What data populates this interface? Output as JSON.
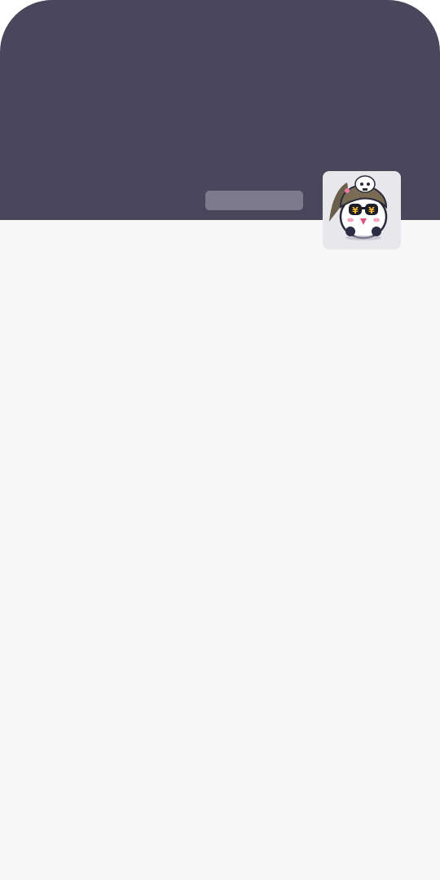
{
  "colors": {
    "header_background": "#4a475d",
    "page_background": "#f7f7f7",
    "placeholder_bar": "#7c7a8a",
    "avatar_background": "#e8e8ec"
  },
  "header": {
    "name_placeholder_state": "loading"
  },
  "avatar": {
    "icon": "penguin-character-with-money-sunglasses-and-skull-hat"
  }
}
